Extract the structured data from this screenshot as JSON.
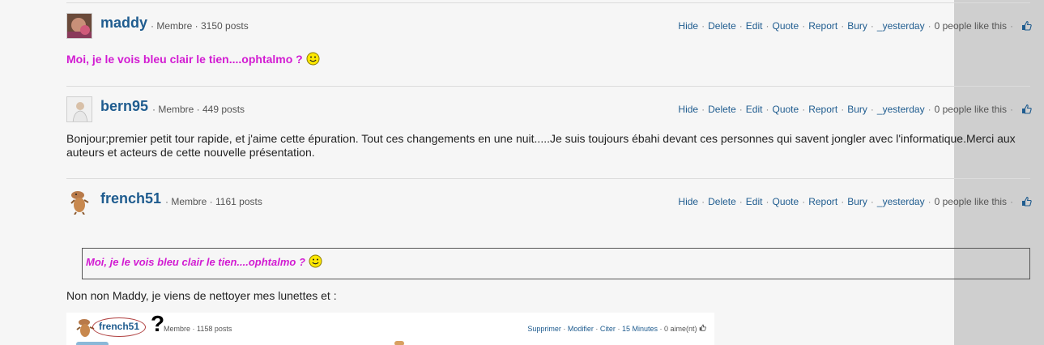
{
  "posts": [
    {
      "username": "maddy",
      "meta": "· Membre · 3150 posts",
      "message": "Moi, je le vois bleu clair le tien....ophtalmo ?"
    },
    {
      "username": "bern95",
      "meta": "· Membre · 449 posts",
      "message": "Bonjour;premier petit tour rapide, et j'aime cette épuration. Tout ces changements en une nuit.....Je suis toujours ébahi devant ces personnes qui savent jongler avec l'informatique.Merci aux auteurs et acteurs de cette nouvelle présentation."
    },
    {
      "username": "french51",
      "meta": "· Membre · 1161 posts",
      "quote": "Moi, je le vois bleu clair le tien....ophtalmo ?",
      "message": "Non non Maddy, je viens de nettoyer mes lunettes et :"
    }
  ],
  "actions": {
    "hide": "Hide",
    "delete": "Delete",
    "edit": "Edit",
    "quote": "Quote",
    "report": "Report",
    "bury": "Bury",
    "time": "_yesterday",
    "likes": "0 people like this"
  },
  "embedded_screenshot": {
    "username": "french51",
    "meta": "Membre · 1158 posts",
    "question_mark": "?",
    "supprimer": "Supprimer",
    "modifier": "Modifier",
    "citer": "Citer",
    "time": "15 Minutes",
    "likes": "0 aime(nt)"
  },
  "colors": {
    "link": "#1f5c8f",
    "pink_quote": "#d21bd2",
    "background": "#f6f6f6"
  },
  "icons": [
    "thumbs-up-icon",
    "smiley-icon",
    "avatar"
  ]
}
